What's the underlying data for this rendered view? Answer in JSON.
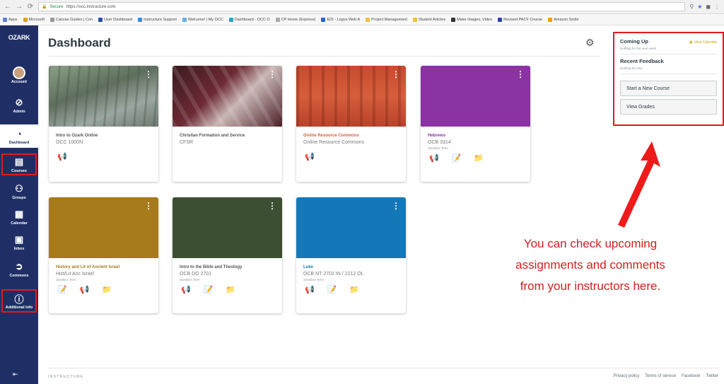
{
  "browser": {
    "url_label": "Secure",
    "url": "https://occ.instructure.com",
    "bookmarks": [
      "Apps",
      "Microsoft",
      "Canvas Guides | Con",
      "User Dashboard",
      "Instructure Support",
      "Welcome! | My OCC",
      "Dashboard - OCC O",
      "CP Home (Express)",
      "EDI - Logos Web A",
      "Project Management",
      "Student Articles",
      "Make Images, Video",
      "Revised PACF Course",
      "Amazon Smile"
    ]
  },
  "global_nav": {
    "logo": "OZARK",
    "items": [
      {
        "label": "Account"
      },
      {
        "label": "Admin"
      },
      {
        "label": "Dashboard"
      },
      {
        "label": "Courses"
      },
      {
        "label": "Groups"
      },
      {
        "label": "Calendar"
      },
      {
        "label": "Inbox"
      },
      {
        "label": "Commons"
      },
      {
        "label": "Additional Info"
      }
    ]
  },
  "header": {
    "title": "Dashboard"
  },
  "cards": [
    {
      "name": "Intro to Ozark Online",
      "code": "OCC 1000N",
      "term": "",
      "color": "#8aa086",
      "name_color": "#555555"
    },
    {
      "name": "Christian Formation and Service",
      "code": "CFSR",
      "term": "",
      "color": "#6d2a34",
      "name_color": "#555555"
    },
    {
      "name": "Online Resource Commons",
      "code": "Online Resource Commons",
      "term": "",
      "color": "#d65e3c",
      "name_color": "#d65e3c"
    },
    {
      "name": "Hebrews",
      "code": "OCB 3314",
      "term": "Sandbox Term",
      "color": "#8b33a3",
      "name_color": "#8b33a3"
    },
    {
      "name": "History and Lit of Ancient Israel",
      "code": "Hist/Lit Anc Israel",
      "term": "Sandbox Term",
      "color": "#a77a1c",
      "name_color": "#a77a1c"
    },
    {
      "name": "Intro to the Bible and Theology",
      "code": "OCB DO 2701",
      "term": "Sandbox Term",
      "color": "#3d4f33",
      "name_color": "#555555"
    },
    {
      "name": "Luke",
      "code": "OCB NT 2702 IN / 2212 OL",
      "term": "Sandbox Term",
      "color": "#1478b8",
      "name_color": "#1478b8"
    }
  ],
  "sidebar": {
    "coming_up": "Coming Up",
    "view_calendar": "View Calendar",
    "nothing_next_week": "Nothing for the next week",
    "recent_feedback": "Recent Feedback",
    "nothing_now": "Nothing for now",
    "start_course": "Start a New Course",
    "view_grades": "View Grades"
  },
  "annotation": {
    "lines": [
      "You can check upcoming",
      "assignments and comments",
      "from your instructors here."
    ],
    "color": "#d21f1f"
  },
  "footer": {
    "brand": "INSTRUCTURE",
    "links": [
      "Privacy policy",
      "Terms of service",
      "Facebook",
      "Twitter"
    ]
  }
}
